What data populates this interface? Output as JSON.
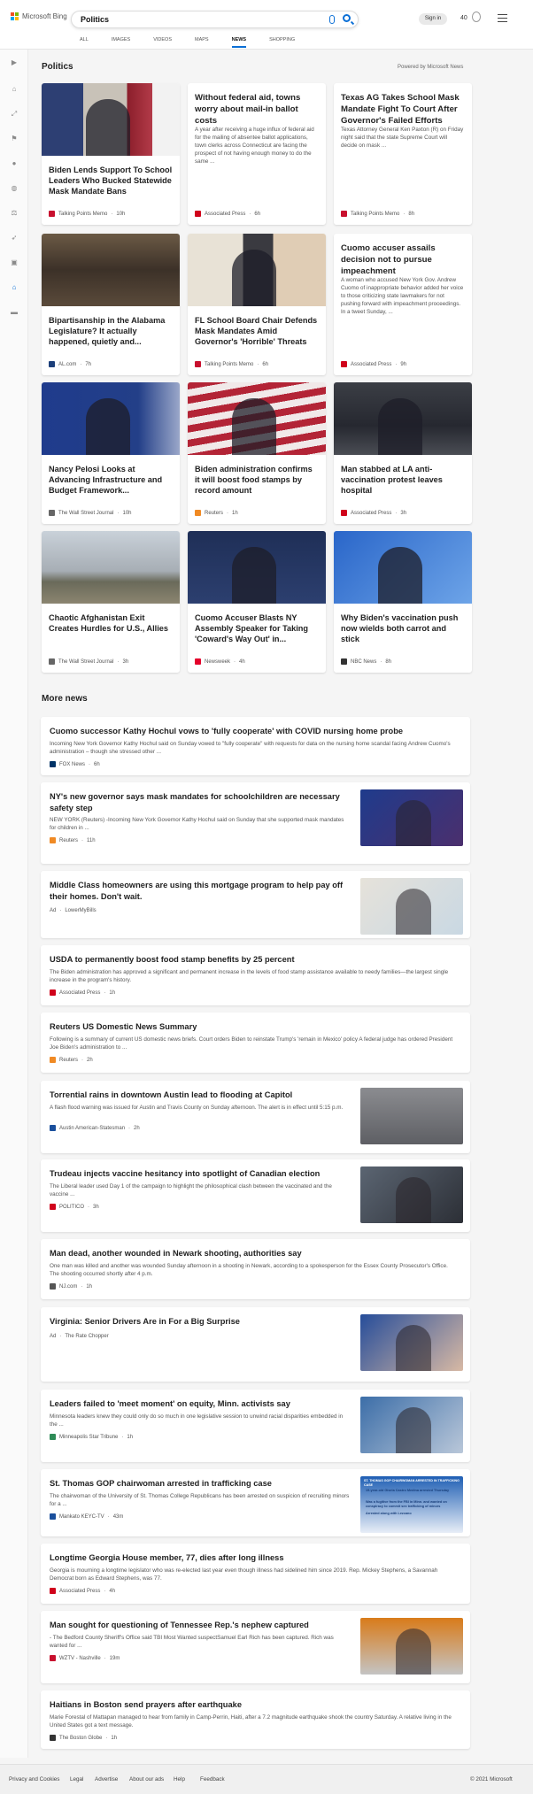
{
  "header": {
    "logo_text": "Microsoft Bing",
    "search_query": "Politics",
    "signin_label": "Sign in",
    "points": "40",
    "tabs": [
      "ALL",
      "IMAGES",
      "VIDEOS",
      "MAPS",
      "NEWS",
      "SHOPPING"
    ],
    "active_tab": "NEWS"
  },
  "section_title": "Politics",
  "powered_by": "Powered by Microsoft News",
  "cards": [
    {
      "title": "Biden Lends Support To School Leaders Who Bucked Statewide Mask Mandate Bans",
      "source": "Talking Points Memo",
      "time": "10h",
      "src_color": "#c8102e"
    },
    {
      "title": "Without federal aid, towns worry about mail-in ballot costs",
      "desc": "A year after receiving a huge influx of federal aid for the mailing of absentee ballot applications, town clerks across Connecticut are facing the prospect of not having enough money to do the same ...",
      "source": "Associated Press",
      "time": "6h",
      "src_color": "#d0021b"
    },
    {
      "title": "Texas AG Takes School Mask Mandate Fight To Court After Governor's Failed Efforts",
      "desc": "Texas Attorney General Ken Paxton (R) on Friday night said that the state Supreme Court will decide on mask ...",
      "source": "Talking Points Memo",
      "time": "8h",
      "src_color": "#c8102e"
    },
    {
      "title": "Bipartisanship in the Alabama Legislature? It actually happened, quietly and...",
      "source": "AL.com",
      "time": "7h",
      "src_color": "#1c3f7a"
    },
    {
      "title": "FL School Board Chair Defends Mask Mandates Amid Governor's 'Horrible' Threats",
      "source": "Talking Points Memo",
      "time": "6h",
      "src_color": "#c8102e"
    },
    {
      "title": "Cuomo accuser assails decision not to pursue impeachment",
      "desc": "A woman who accused New York Gov. Andrew Cuomo of inappropriate behavior added her voice to those criticizing state lawmakers for not pushing forward with impeachment proceedings. In a tweet Sunday, ...",
      "source": "Associated Press",
      "time": "9h",
      "src_color": "#d0021b"
    },
    {
      "title": "Nancy Pelosi Looks at Advancing Infrastructure and Budget Framework...",
      "source": "The Wall Street Journal",
      "time": "10h",
      "src_color": "#666666"
    },
    {
      "title": "Biden administration confirms it will boost food stamps by record amount",
      "source": "Reuters",
      "time": "1h",
      "src_color": "#f08a24"
    },
    {
      "title": "Man stabbed at LA anti-vaccination protest leaves hospital",
      "source": "Associated Press",
      "time": "3h",
      "src_color": "#d0021b"
    },
    {
      "title": "Chaotic Afghanistan Exit Creates Hurdles for U.S., Allies",
      "source": "The Wall Street Journal",
      "time": "3h",
      "src_color": "#666666"
    },
    {
      "title": "Cuomo Accuser Blasts NY Assembly Speaker for Taking 'Coward's Way Out' in...",
      "source": "Newsweek",
      "time": "4h",
      "src_color": "#e4002b"
    },
    {
      "title": "Why Biden's vaccination push now wields both carrot and stick",
      "source": "NBC News",
      "time": "8h",
      "src_color": "#333333"
    }
  ],
  "more_news_title": "More news",
  "more_news": [
    {
      "title": "Cuomo successor Kathy Hochul vows to 'fully cooperate' with COVID nursing home probe",
      "desc": "Incoming New York Governor Kathy Hochul said on Sunday vowed to \"fully cooperate\" with requests for data on the nursing home scandal facing Andrew Cuomo's administration – though she stressed other ...",
      "source": "FOX News",
      "time": "6h",
      "src_color": "#003366"
    },
    {
      "title": "NY's new governor says mask mandates for schoolchildren are necessary safety step",
      "desc": "NEW YORK (Reuters) -Incoming New York Governor Kathy Hochul said on Sunday that she supported mask mandates for children in ...",
      "source": "Reuters",
      "time": "11h",
      "src_color": "#f08a24"
    },
    {
      "title": "Middle Class homeowners are using this mortgage program to help pay off their homes. Don't wait.",
      "source": "LowerMyBills",
      "ad": "Ad"
    },
    {
      "title": "USDA to permanently boost food stamp benefits by 25 percent",
      "desc": "The Biden administration has approved a significant and permanent increase in the levels of food stamp assistance available to needy families—the largest single increase in the program's history.",
      "source": "Associated Press",
      "time": "1h",
      "src_color": "#d0021b"
    },
    {
      "title": "Reuters US Domestic News Summary",
      "desc": "Following is a summary of current US domestic news briefs. Court orders Biden to reinstate Trump's 'remain in Mexico' policy A federal judge has ordered President Joe Biden's administration to ...",
      "source": "Reuters",
      "time": "2h",
      "src_color": "#f08a24"
    },
    {
      "title": "Torrential rains in downtown Austin lead to flooding at Capitol",
      "desc": "A flash flood warning was issued for Austin and Travis County on Sunday afternoon. The alert is in effect until 5:15 p.m.",
      "source": "Austin American-Statesman",
      "time": "2h",
      "src_color": "#1a4f9c"
    },
    {
      "title": "Trudeau injects vaccine hesitancy into spotlight of Canadian election",
      "desc": "The Liberal leader used Day 1 of the campaign to highlight the philosophical clash between the vaccinated and the vaccine ...",
      "source": "POLITICO",
      "time": "3h",
      "src_color": "#d0021b"
    },
    {
      "title": "Man dead, another wounded in Newark shooting, authorities say",
      "desc": "One man was killed and another was wounded Sunday afternoon in a shooting in Newark, according to a spokesperson for the Essex County Prosecutor's Office. The shooting occurred shortly after 4 p.m.",
      "source": "NJ.com",
      "time": "1h",
      "src_color": "#555555"
    },
    {
      "title": "Virginia: Senior Drivers Are in For a Big Surprise",
      "source": "The Rate Chopper",
      "ad": "Ad"
    },
    {
      "title": "Leaders failed to 'meet moment' on equity, Minn. activists say",
      "desc": "Minnesota leaders knew they could only do so much in one legislative session to unwind racial disparities embedded in the ...",
      "source": "Minneapolis Star Tribune",
      "time": "1h",
      "src_color": "#2e8b57"
    },
    {
      "title": "St. Thomas GOP chairwoman arrested in trafficking case",
      "desc": "The chairwoman of the University of St. Thomas College Republicans has been arrested on suspicion of recruiting minors for a ...",
      "source": "Mankato KEYC-TV",
      "time": "43m",
      "src_color": "#1a4f9c"
    },
    {
      "title": "Longtime Georgia House member, 77, dies after long illness",
      "desc": "Georgia is mourning a longtime legislator who was re-elected last year even though illness had sidelined him since 2019. Rep. Mickey Stephens, a Savannah Democrat born as Edward Stephens, was 77.",
      "source": "Associated Press",
      "time": "4h",
      "src_color": "#d0021b"
    },
    {
      "title": "Man sought for questioning of Tennessee Rep.'s nephew captured",
      "desc": "- The Bedford County Sheriff's Office said TBI Most Wanted suspectSamuel Earl Rich has been captured. Rich was wanted for ...",
      "source": "WZTV - Nashville",
      "time": "19m",
      "src_color": "#c8102e"
    },
    {
      "title": "Haitians in Boston send prayers after earthquake",
      "desc": "Marie Forestal of Mattapan managed to hear from family in Camp-Perrin, Haiti, after a 7.2 magnitude earthquake shook the country Saturday. A relative living in the United States got a text message.",
      "source": "The Boston Globe",
      "time": "1h",
      "src_color": "#333333"
    }
  ],
  "thumb_text": {
    "headline": "ST. THOMAS GOP CHAIRWOMAN ARRESTED IN TRAFFICKING CASE",
    "bullets": [
      "19-year-old Gisela Castro Medina arrested Thursday",
      "Was a fugitive from the FBI in Minn. and wanted on conspiracy to commit sex trafficking of minors",
      "Arrested along with Lezcano"
    ]
  },
  "footer": {
    "links": [
      "Privacy and Cookies",
      "Legal",
      "Advertise",
      "About our ads",
      "Help",
      "Feedback"
    ],
    "copyright": "© 2021 Microsoft"
  }
}
